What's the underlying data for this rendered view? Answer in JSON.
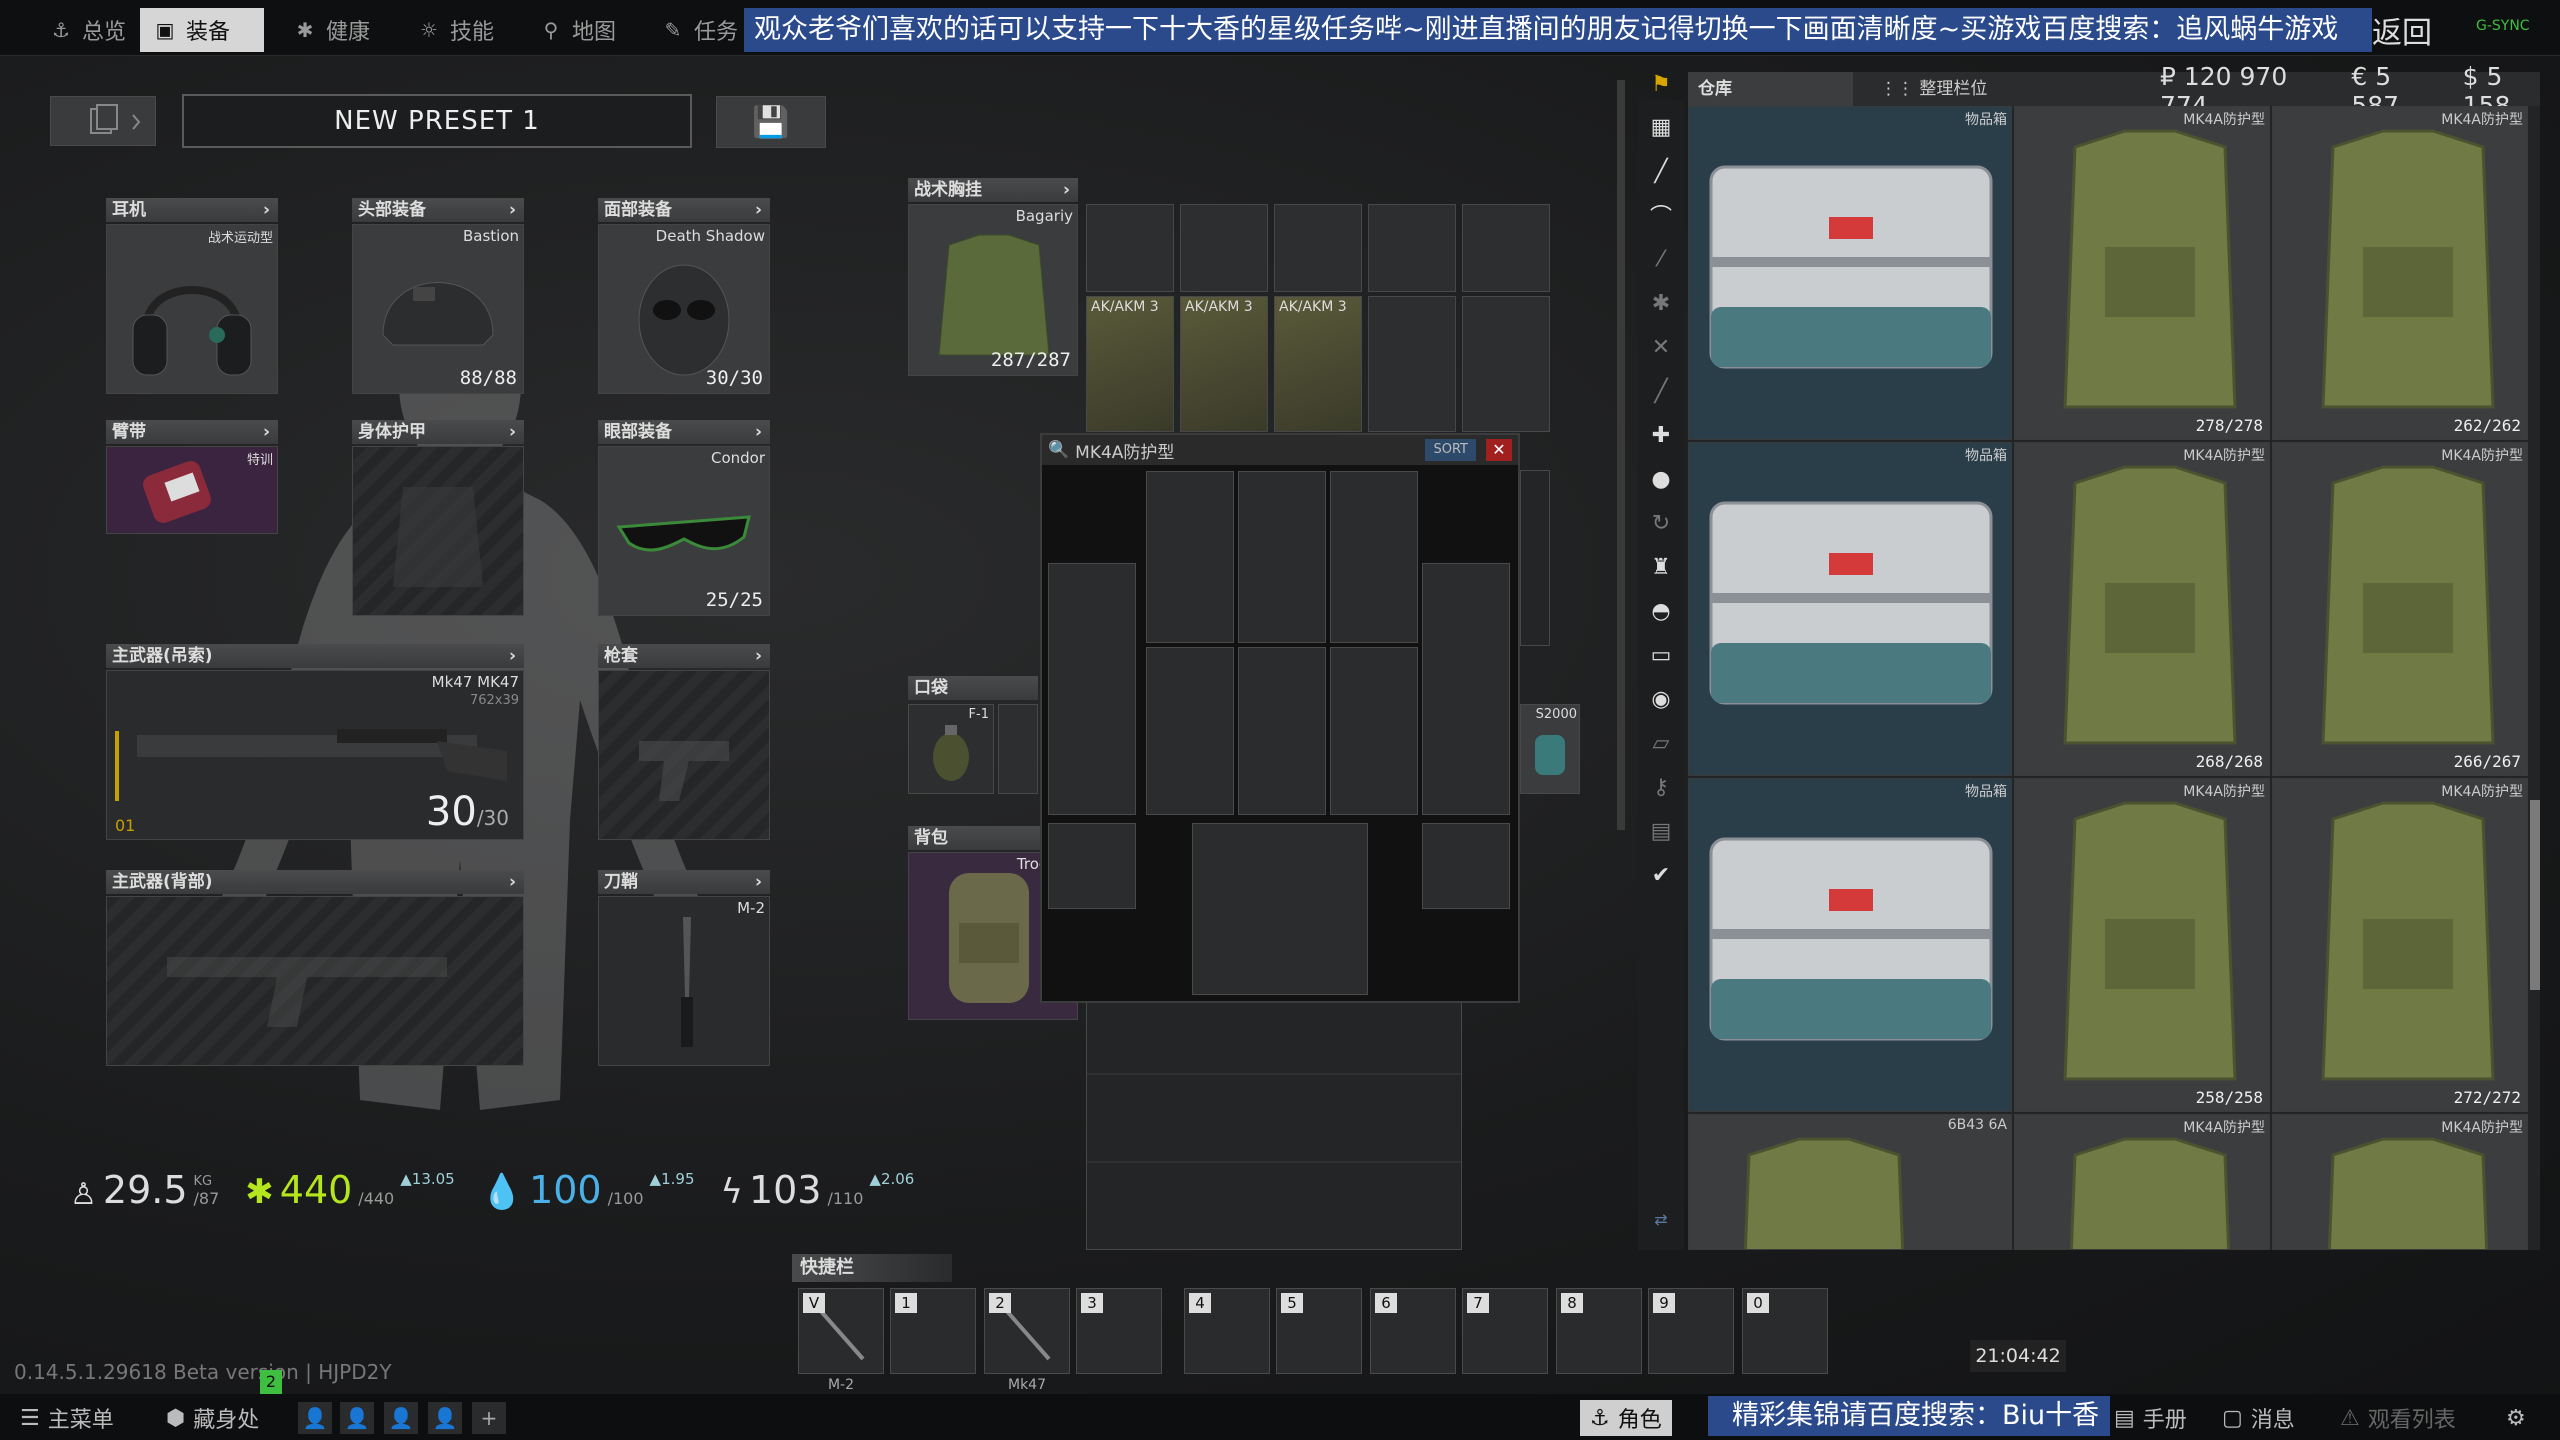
{
  "nav": {
    "tabs": [
      {
        "label": "总览",
        "icon": "anchor-icon"
      },
      {
        "label": "装备",
        "icon": "gear-icon"
      },
      {
        "label": "健康",
        "icon": "health-icon"
      },
      {
        "label": "技能",
        "icon": "sun-icon"
      },
      {
        "label": "地图",
        "icon": "pin-icon"
      },
      {
        "label": "任务",
        "icon": "note-icon"
      }
    ],
    "banner": "观众老爷们喜欢的话可以支持一下十大香的星级任务哔~刚进直播间的朋友记得切换一下画面清晰度~买游戏百度搜索：追风蜗牛游戏",
    "back": "返回",
    "build": "G-SYNC"
  },
  "preset": {
    "name": "NEW PRESET 1"
  },
  "slots": {
    "earpiece": {
      "label": "耳机",
      "item": "战术运动型"
    },
    "headwear": {
      "label": "头部装备",
      "item": "Bastion",
      "dur": "88/88"
    },
    "face": {
      "label": "面部装备",
      "item": "Death Shadow",
      "dur": "30/30"
    },
    "armband": {
      "label": "臂带",
      "item": "特训"
    },
    "body_armor": {
      "label": "身体护甲"
    },
    "eyewear": {
      "label": "眼部装备",
      "item": "Condor",
      "dur": "25/25"
    },
    "primary": {
      "label": "主武器(吊索)",
      "item": "Mk47  MK47",
      "caliber": "762x39",
      "ammo": "30",
      "ammo_max": "/30",
      "badge": "01"
    },
    "holster": {
      "label": "枪套"
    },
    "primary2": {
      "label": "主武器(背部)"
    },
    "scabbard": {
      "label": "刀鞘",
      "item": "M-2"
    }
  },
  "stats": {
    "weight": "29.5",
    "weight_unit": "KG",
    "weight_max": "/87",
    "energy": "440",
    "energy_max": "/440",
    "energy_up": "13.05",
    "hydration": "100",
    "hydration_max": "/100",
    "hydration_up": "1.95",
    "stamina": "103",
    "stamina_max": "/110",
    "stamina_up": "2.06"
  },
  "rig": {
    "label": "战术胸挂",
    "item": "Bagariy",
    "dur": "287/287",
    "mags": [
      "AK/AKM 3",
      "AK/AKM 3",
      "AK/AKM 3"
    ]
  },
  "pockets": {
    "label": "口袋",
    "item": "F-1",
    "item2": "S2000"
  },
  "backpack": {
    "label": "背包",
    "item": "Trooper"
  },
  "popup": {
    "title": "MK4A防护型",
    "sort": "SORT",
    "close": "✕"
  },
  "stash": {
    "tab1": "仓库",
    "tab2": "整理栏位",
    "rub": "₽ 120 970 774",
    "eur": "€ 5 587",
    "usd": "$ 5 158",
    "items": [
      {
        "name": "物品箱",
        "type": "case"
      },
      {
        "name": "MK4A防护型",
        "dur": "278/278"
      },
      {
        "name": "MK4A防护型",
        "dur": "262/262"
      },
      {
        "name": "物品箱",
        "type": "case"
      },
      {
        "name": "MK4A防护型",
        "dur": "268/268"
      },
      {
        "name": "MK4A防护型",
        "dur": "266/267"
      },
      {
        "name": "物品箱",
        "type": "case"
      },
      {
        "name": "MK4A防护型",
        "dur": "258/258"
      },
      {
        "name": "MK4A防护型",
        "dur": "272/272"
      },
      {
        "name": "6B43 6A"
      },
      {
        "name": "MK4A防护型"
      },
      {
        "name": "MK4A防护型"
      }
    ]
  },
  "quickbar": {
    "label": "快捷栏",
    "keys": [
      "V",
      "1",
      "2",
      "3",
      "4",
      "5",
      "6",
      "7",
      "8",
      "9",
      "0"
    ],
    "items": {
      "V": "M-2",
      "2": "Mk47"
    }
  },
  "footer": {
    "version": "0.14.5.1.29618 Beta version | HJPD2Y",
    "badge": "2",
    "clock": "21:04:42",
    "main_menu": "主菜单",
    "hideout": "藏身处",
    "character": "角色",
    "banner": "精彩集锦请百度搜索：Biu十香",
    "handbook": "手册",
    "messages": "消息",
    "watchlist": "观看列表"
  },
  "colors": {
    "accent_blue": "#2a4a8c",
    "green": "#3fbf3f",
    "energy": "#b5e61d"
  }
}
